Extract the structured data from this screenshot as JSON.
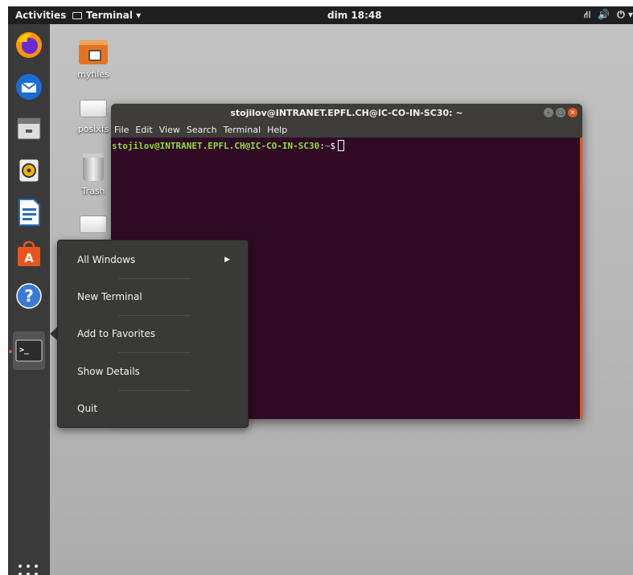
{
  "topbar": {
    "activities": "Activities",
    "app_name": "Terminal ▾",
    "clock": "dim 18:48",
    "tray_network": "⛙",
    "tray_volume": "🔊",
    "tray_power": "⏻ ▾"
  },
  "dock": {
    "items": [
      "firefox-icon",
      "thunderbird-icon",
      "files-icon",
      "rhythmbox-icon",
      "writer-icon",
      "software-icon",
      "help-icon",
      "terminal-icon"
    ],
    "help_glyph": "?",
    "terminal_glyph": ">_",
    "software_glyph": "A"
  },
  "desktop": {
    "icons": [
      {
        "label": "myfiles"
      },
      {
        "label": "posixfs"
      },
      {
        "label": "Trash"
      },
      {
        "label": ""
      }
    ]
  },
  "terminal": {
    "title": "stojilov@INTRANET.EPFL.CH@IC-CO-IN-SC30: ~",
    "menu": [
      "File",
      "Edit",
      "View",
      "Search",
      "Terminal",
      "Help"
    ],
    "prompt_user": "stojilov@INTRANET.EPFL.CH@IC-CO-IN-SC30",
    "prompt_colon": ":",
    "prompt_path": "~",
    "prompt_symbol": "$",
    "buttons": {
      "min": "–",
      "max": "□",
      "close": "×"
    }
  },
  "context_menu": {
    "items": [
      {
        "label": "All Windows",
        "submenu": true
      },
      {
        "label": "New Terminal"
      },
      {
        "label": "Add to Favorites"
      },
      {
        "label": "Show Details"
      },
      {
        "label": "Quit"
      }
    ],
    "submenu_arrow": "▶"
  },
  "colors": {
    "accent": "#e95420",
    "terminal_bg": "#300a24",
    "prompt_user": "#8ae234",
    "prompt_path": "#729fcf"
  }
}
